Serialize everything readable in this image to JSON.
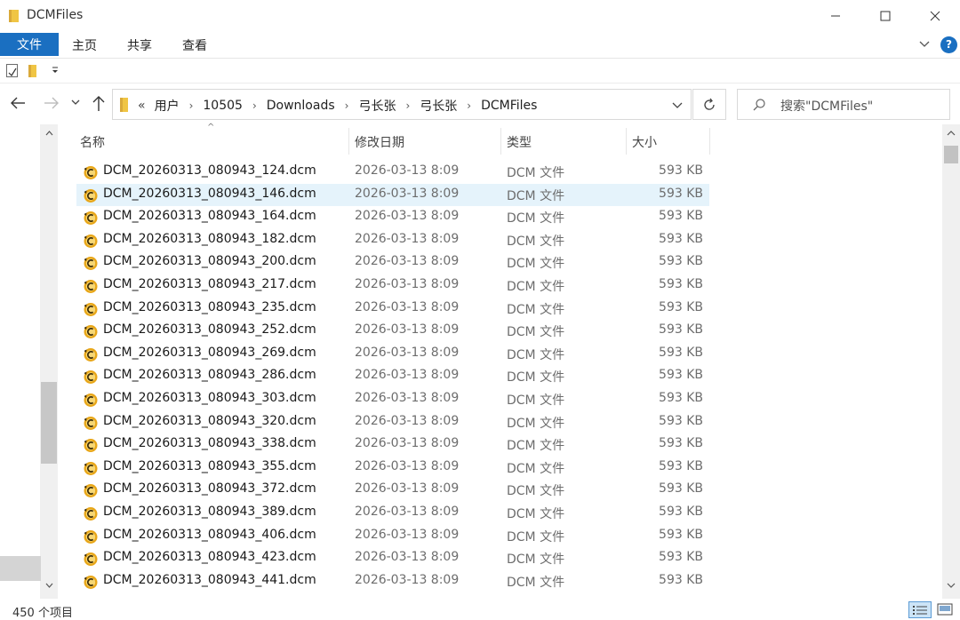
{
  "window": {
    "title": "DCMFiles"
  },
  "ribbon": {
    "file": "文件",
    "home": "主页",
    "share": "共享",
    "view": "查看"
  },
  "help_label": "?",
  "address": {
    "overflow": "«",
    "crumbs": [
      "用户",
      "10505",
      "Downloads",
      "弓长张",
      "弓长张",
      "DCMFiles"
    ],
    "separator": "›"
  },
  "search": {
    "placeholder": "搜索\"DCMFiles\""
  },
  "columns": {
    "name": "名称",
    "date": "修改日期",
    "type": "类型",
    "size": "大小"
  },
  "files": [
    {
      "name": "DCM_20260313_080943_124.dcm",
      "date": "2026-03-13 8:09",
      "type": "DCM 文件",
      "size": "593 KB"
    },
    {
      "name": "DCM_20260313_080943_146.dcm",
      "date": "2026-03-13 8:09",
      "type": "DCM 文件",
      "size": "593 KB",
      "selected": true
    },
    {
      "name": "DCM_20260313_080943_164.dcm",
      "date": "2026-03-13 8:09",
      "type": "DCM 文件",
      "size": "593 KB"
    },
    {
      "name": "DCM_20260313_080943_182.dcm",
      "date": "2026-03-13 8:09",
      "type": "DCM 文件",
      "size": "593 KB"
    },
    {
      "name": "DCM_20260313_080943_200.dcm",
      "date": "2026-03-13 8:09",
      "type": "DCM 文件",
      "size": "593 KB"
    },
    {
      "name": "DCM_20260313_080943_217.dcm",
      "date": "2026-03-13 8:09",
      "type": "DCM 文件",
      "size": "593 KB"
    },
    {
      "name": "DCM_20260313_080943_235.dcm",
      "date": "2026-03-13 8:09",
      "type": "DCM 文件",
      "size": "593 KB"
    },
    {
      "name": "DCM_20260313_080943_252.dcm",
      "date": "2026-03-13 8:09",
      "type": "DCM 文件",
      "size": "593 KB"
    },
    {
      "name": "DCM_20260313_080943_269.dcm",
      "date": "2026-03-13 8:09",
      "type": "DCM 文件",
      "size": "593 KB"
    },
    {
      "name": "DCM_20260313_080943_286.dcm",
      "date": "2026-03-13 8:09",
      "type": "DCM 文件",
      "size": "593 KB"
    },
    {
      "name": "DCM_20260313_080943_303.dcm",
      "date": "2026-03-13 8:09",
      "type": "DCM 文件",
      "size": "593 KB"
    },
    {
      "name": "DCM_20260313_080943_320.dcm",
      "date": "2026-03-13 8:09",
      "type": "DCM 文件",
      "size": "593 KB"
    },
    {
      "name": "DCM_20260313_080943_338.dcm",
      "date": "2026-03-13 8:09",
      "type": "DCM 文件",
      "size": "593 KB"
    },
    {
      "name": "DCM_20260313_080943_355.dcm",
      "date": "2026-03-13 8:09",
      "type": "DCM 文件",
      "size": "593 KB"
    },
    {
      "name": "DCM_20260313_080943_372.dcm",
      "date": "2026-03-13 8:09",
      "type": "DCM 文件",
      "size": "593 KB"
    },
    {
      "name": "DCM_20260313_080943_389.dcm",
      "date": "2026-03-13 8:09",
      "type": "DCM 文件",
      "size": "593 KB"
    },
    {
      "name": "DCM_20260313_080943_406.dcm",
      "date": "2026-03-13 8:09",
      "type": "DCM 文件",
      "size": "593 KB"
    },
    {
      "name": "DCM_20260313_080943_423.dcm",
      "date": "2026-03-13 8:09",
      "type": "DCM 文件",
      "size": "593 KB"
    },
    {
      "name": "DCM_20260313_080943_441.dcm",
      "date": "2026-03-13 8:09",
      "type": "DCM 文件",
      "size": "593 KB"
    }
  ],
  "status": {
    "item_count": "450 个项目"
  },
  "colors": {
    "accent": "#1a6fc1",
    "selection": "#e5f3fb",
    "folder": "#f0c544"
  }
}
